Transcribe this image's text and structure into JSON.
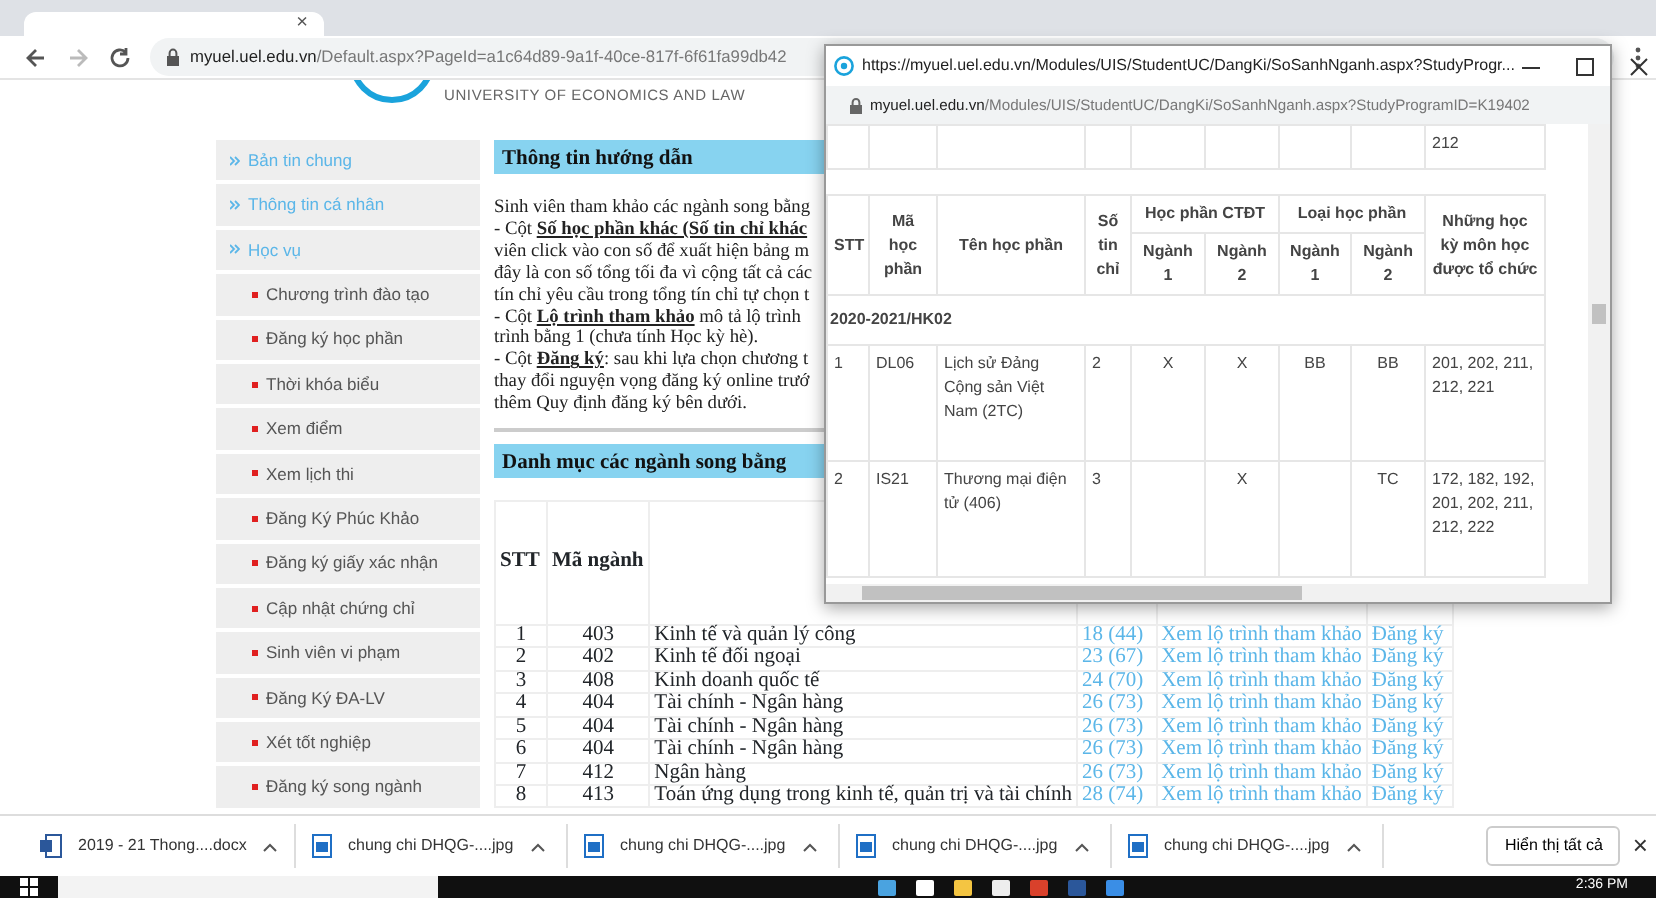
{
  "browser": {
    "tab_close": "×",
    "address": {
      "host": "myuel.uel.edu.vn",
      "path": "/Default.aspx?PageId=a1c64d89-9a1f-40ce-817f-6f61fa99db42"
    }
  },
  "header": {
    "university": "UNIVERSITY OF ECONOMICS AND LAW"
  },
  "sidebar": {
    "items": [
      {
        "label": "Bản tin chung"
      },
      {
        "label": "Thông tin cá nhân"
      },
      {
        "label": "Học vụ",
        "children": [
          {
            "label": "Chương trình đào tạo"
          },
          {
            "label": "Đăng ký học phần"
          },
          {
            "label": "Thời khóa biểu"
          },
          {
            "label": "Xem điểm"
          },
          {
            "label": "Xem lịch thi"
          },
          {
            "label": "Đăng Ký Phúc Khảo"
          },
          {
            "label": "Đăng ký giấy xác nhận"
          },
          {
            "label": "Cập nhật chứng chỉ"
          },
          {
            "label": "Sinh viên vi phạm"
          },
          {
            "label": "Đăng Ký ĐA-LV"
          },
          {
            "label": "Xét tốt nghiệp"
          },
          {
            "label": "Đăng ký song ngành"
          }
        ]
      }
    ]
  },
  "guide": {
    "title": "Thông tin hướng dẫn",
    "lines": [
      "Sinh viên tham khảo các ngành song bằng",
      "- Cột **Số học phần khác (Số tin chỉ khác**",
      "viên click vào con số để xuất hiện bảng m",
      "đây là con số tổng tối đa vì cộng tất cả các",
      "tín chỉ yêu cầu trong tổng tín chỉ tự chọn t",
      "- Cột **Lộ trình tham khảo** mô tả lộ trình",
      "trình bằng 1 (chưa tính Học kỳ hè).",
      "- Cột **Đăng ký**: sau khi lựa chọn chương t",
      "thay đổi nguyện vọng đăng ký online trướ",
      "thêm Quy định đăng ký bên dưới."
    ]
  },
  "majors": {
    "title": "Danh mục các ngành song bằng",
    "columns": [
      "STT",
      "Mã ngành"
    ],
    "rows": [
      {
        "stt": "1",
        "code": "403",
        "name": "Kinh tế và quản lý công",
        "count": "18 (44)",
        "route": "Xem lộ trình tham khảo",
        "register": "Đăng ký"
      },
      {
        "stt": "2",
        "code": "402",
        "name": "Kinh tế đối ngoại",
        "count": "23 (67)",
        "route": "Xem lộ trình tham khảo",
        "register": "Đăng ký"
      },
      {
        "stt": "3",
        "code": "408",
        "name": "Kinh doanh quốc tế",
        "count": "24 (70)",
        "route": "Xem lộ trình tham khảo",
        "register": "Đăng ký"
      },
      {
        "stt": "4",
        "code": "404",
        "name": "Tài chính - Ngân hàng",
        "count": "26 (73)",
        "route": "Xem lộ trình tham khảo",
        "register": "Đăng ký"
      },
      {
        "stt": "5",
        "code": "404",
        "name": "Tài chính - Ngân hàng",
        "count": "26 (73)",
        "route": "Xem lộ trình tham khảo",
        "register": "Đăng ký"
      },
      {
        "stt": "6",
        "code": "404",
        "name": "Tài chính - Ngân hàng",
        "count": "26 (73)",
        "route": "Xem lộ trình tham khảo",
        "register": "Đăng ký"
      },
      {
        "stt": "7",
        "code": "412",
        "name": "Ngân hàng",
        "count": "26 (73)",
        "route": "Xem lộ trình tham khảo",
        "register": "Đăng ký"
      },
      {
        "stt": "8",
        "code": "413",
        "name": "Toán ứng dụng trong kinh tế, quản trị và tài chính",
        "count": "28 (74)",
        "route": "Xem lộ trình tham khảo",
        "register": "Đăng ký"
      }
    ]
  },
  "popup": {
    "title": "https://myuel.uel.edu.vn/Modules/UIS/StudentUC/DangKi/SoSanhNganh.aspx?StudyProgr...",
    "address": {
      "host": "myuel.uel.edu.vn",
      "path": "/Modules/UIS/StudentUC/DangKi/SoSanhNganh.aspx?StudyProgramID=K19402"
    },
    "partial_row_last_cell": "212",
    "columns": [
      "STT",
      "Mã học phần",
      "Tên học phần",
      "Số tin chỉ"
    ],
    "groups": [
      {
        "label": "Học phần CTĐT",
        "sub": [
          "Ngành 1",
          "Ngành 2"
        ]
      },
      {
        "label": "Loại học phần",
        "sub": [
          "Ngành 1",
          "Ngành 2"
        ]
      }
    ],
    "last_column": "Những học kỳ môn học được tổ chức",
    "semester": "2020-2021/HK02",
    "rows": [
      [
        "1",
        "DL06",
        "Lịch sử Đảng Cộng sản Việt Nam (2TC)",
        "2",
        "X",
        "X",
        "BB",
        "BB",
        "201, 202, 211, 212, 221"
      ],
      [
        "2",
        "IS21",
        "Thương mại điện tử (406)",
        "3",
        "",
        "X",
        "",
        "TC",
        "172, 182, 192, 201, 202, 211, 212, 222"
      ]
    ]
  },
  "downloads": {
    "items": [
      {
        "name": "2019 - 21 Thong....docx",
        "kind": "doc"
      },
      {
        "name": "chung chi DHQG-....jpg",
        "kind": "image"
      },
      {
        "name": "chung chi DHQG-....jpg",
        "kind": "image"
      },
      {
        "name": "chung chi DHQG-....jpg",
        "kind": "image"
      },
      {
        "name": "chung chi DHQG-....jpg",
        "kind": "image"
      }
    ],
    "show_all": "Hiển thị tất cả",
    "close": "×"
  },
  "taskbar": {
    "time": "2:36 PM"
  }
}
